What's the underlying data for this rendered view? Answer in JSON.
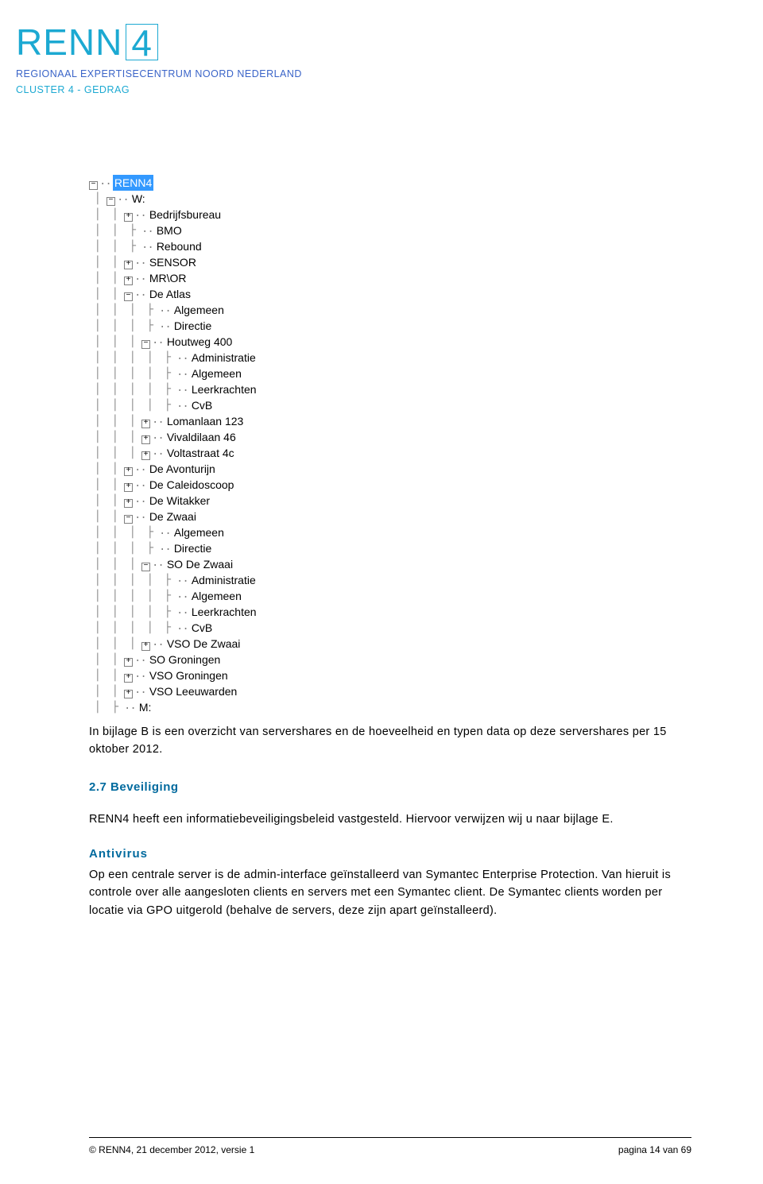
{
  "logo": {
    "main_left": "RENN",
    "main_right": "4",
    "sub1": "REGIONAAL EXPERTISECENTRUM NOORD NEDERLAND",
    "sub2": "CLUSTER 4 - GEDRAG"
  },
  "tree": [
    {
      "depth": 0,
      "expander": "minus",
      "label": "RENN4",
      "selected": true
    },
    {
      "depth": 1,
      "expander": "minus",
      "label": "W:"
    },
    {
      "depth": 2,
      "expander": "plus",
      "label": "Bedrijfsbureau"
    },
    {
      "depth": 2,
      "expander": "none",
      "label": "BMO"
    },
    {
      "depth": 2,
      "expander": "none",
      "label": "Rebound"
    },
    {
      "depth": 2,
      "expander": "plus",
      "label": "SENSOR"
    },
    {
      "depth": 2,
      "expander": "plus",
      "label": "MR\\OR"
    },
    {
      "depth": 2,
      "expander": "minus",
      "label": "De Atlas"
    },
    {
      "depth": 3,
      "expander": "none",
      "label": "Algemeen"
    },
    {
      "depth": 3,
      "expander": "none",
      "label": "Directie"
    },
    {
      "depth": 3,
      "expander": "minus",
      "label": "Houtweg 400"
    },
    {
      "depth": 4,
      "expander": "none",
      "label": "Administratie"
    },
    {
      "depth": 4,
      "expander": "none",
      "label": "Algemeen"
    },
    {
      "depth": 4,
      "expander": "none",
      "label": "Leerkrachten"
    },
    {
      "depth": 4,
      "expander": "none",
      "label": "CvB"
    },
    {
      "depth": 3,
      "expander": "plus",
      "label": "Lomanlaan 123"
    },
    {
      "depth": 3,
      "expander": "plus",
      "label": "Vivaldilaan 46"
    },
    {
      "depth": 3,
      "expander": "plus",
      "label": "Voltastraat 4c"
    },
    {
      "depth": 2,
      "expander": "plus",
      "label": "De Avonturijn"
    },
    {
      "depth": 2,
      "expander": "plus",
      "label": "De Caleidoscoop"
    },
    {
      "depth": 2,
      "expander": "plus",
      "label": "De Witakker"
    },
    {
      "depth": 2,
      "expander": "minus",
      "label": "De Zwaai"
    },
    {
      "depth": 3,
      "expander": "none",
      "label": "Algemeen"
    },
    {
      "depth": 3,
      "expander": "none",
      "label": "Directie"
    },
    {
      "depth": 3,
      "expander": "minus",
      "label": "SO De Zwaai"
    },
    {
      "depth": 4,
      "expander": "none",
      "label": "Administratie"
    },
    {
      "depth": 4,
      "expander": "none",
      "label": "Algemeen"
    },
    {
      "depth": 4,
      "expander": "none",
      "label": "Leerkrachten"
    },
    {
      "depth": 4,
      "expander": "none",
      "label": "CvB"
    },
    {
      "depth": 3,
      "expander": "plus",
      "label": "VSO De Zwaai"
    },
    {
      "depth": 2,
      "expander": "plus",
      "label": "SO Groningen"
    },
    {
      "depth": 2,
      "expander": "plus",
      "label": "VSO Groningen"
    },
    {
      "depth": 2,
      "expander": "plus",
      "label": "VSO Leeuwarden"
    },
    {
      "depth": 1,
      "expander": "none",
      "label": "M:"
    }
  ],
  "body": {
    "para1": "In bijlage B is een overzicht van servershares en de hoeveelheid en typen data op deze servershares per 15 oktober 2012.",
    "heading": "2.7 Beveiliging",
    "para2": "RENN4 heeft een informatiebeveiligingsbeleid vastgesteld. Hiervoor verwijzen wij u naar bijlage E.",
    "subheading": "Antivirus",
    "para3": "Op een centrale server is de admin-interface geïnstalleerd van Symantec Enterprise Protection. Van hieruit is controle over alle aangesloten clients en servers met een Symantec client. De Symantec clients worden per locatie via GPO uitgerold (behalve de servers, deze zijn apart geïnstalleerd)."
  },
  "footer": {
    "left": "© RENN4, 21 december 2012, versie 1",
    "right": "pagina 14 van 69"
  }
}
